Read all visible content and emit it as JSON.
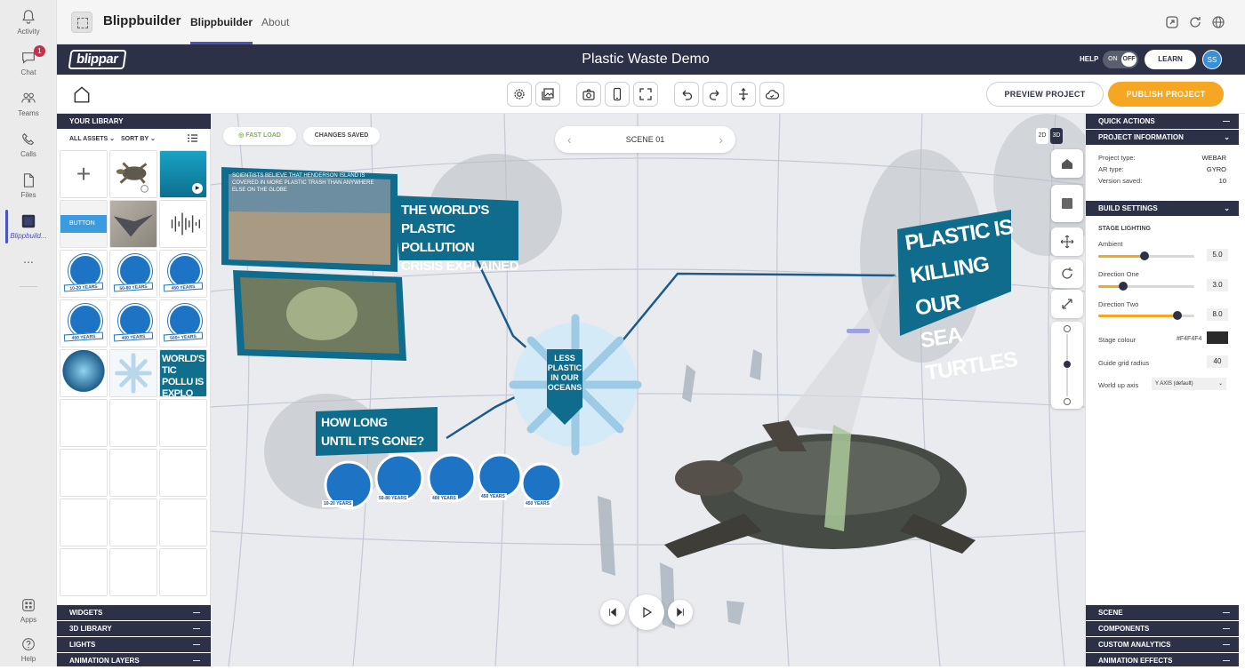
{
  "rail": {
    "items": [
      {
        "label": "Activity",
        "icon": "bell-icon"
      },
      {
        "label": "Chat",
        "icon": "chat-icon",
        "badge": "1"
      },
      {
        "label": "Teams",
        "icon": "teams-icon"
      },
      {
        "label": "Calls",
        "icon": "phone-icon"
      },
      {
        "label": "Files",
        "icon": "file-icon"
      },
      {
        "label": "Blippbuild...",
        "icon": "blippbuilder-app-icon"
      }
    ],
    "more": "...",
    "apps_label": "Apps",
    "help_label": "Help"
  },
  "teams_header": {
    "app_name": "Blippbuilder",
    "tabs": [
      "Blippbuilder",
      "About"
    ],
    "active_tab": "Blippbuilder"
  },
  "blippar_bar": {
    "logo": "blippar",
    "project_title": "Plastic Waste Demo",
    "help_label": "HELP",
    "toggle_on": "ON",
    "toggle_off": "OFF",
    "learn_label": "LEARN",
    "avatar_initials": "SS"
  },
  "toolbar": {
    "preview_label": "PREVIEW PROJECT",
    "publish_label": "PUBLISH PROJECT"
  },
  "library": {
    "title": "YOUR LIBRARY",
    "all_assets": "ALL ASSETS",
    "sort_by": "SORT BY",
    "button_asset": "BUTTON",
    "plastic_tags": [
      "10-20 YEARS",
      "50-80 YEARS",
      "450 YEARS",
      "450 YEARS",
      "400 YEARS",
      "500+ YEARS"
    ],
    "thumb_text": "WORLD'S TIC POLLU IS EXPLO",
    "sections": [
      "WIDGETS",
      "3D LIBRARY",
      "LIGHTS",
      "ANIMATION LAYERS"
    ],
    "collapse_symbol": "—"
  },
  "scene": {
    "fast_load": "FAST LOAD",
    "changes_saved": "CHANGES SAVED",
    "scene_name": "SCENE 01",
    "view_2d": "2D",
    "view_3d": "3D",
    "billboard_text": "SCIENTISTS BELIEVE THAT HENDERSON ISLAND IS COVERED IN MORE PLASTIC TRASH THAN ANYWHERE ELSE ON THE GLOBE",
    "headline_crisis": [
      "THE WORLD'S",
      "PLASTIC POLLUTION",
      "CRISIS EXPLAINED"
    ],
    "headline_turtles": [
      "PLASTIC IS",
      "KILLING OUR",
      "SEA TURTLES"
    ],
    "headline_howlong": [
      "HOW LONG",
      "UNTIL IT'S GONE?"
    ],
    "center_badge": [
      "LESS",
      "PLASTIC",
      "IN OUR",
      "OCEANS"
    ],
    "year_tags": [
      "10-20 YEARS",
      "50-80 YEARS",
      "400 YEARS",
      "450 YEARS",
      "450 YEARS"
    ]
  },
  "right_panel": {
    "quick_actions": "QUICK ACTIONS",
    "project_information": "PROJECT INFORMATION",
    "project_type_label": "Project type:",
    "project_type": "WEBAR",
    "ar_type_label": "AR type:",
    "ar_type": "GYRO",
    "version_label": "Version saved:",
    "version": "10",
    "build_settings": "BUILD SETTINGS",
    "stage_lighting": "STAGE LIGHTING",
    "ambient_label": "Ambient",
    "ambient_value": "5.0",
    "ambient_level": 0.48,
    "dir_one_label": "Direction One",
    "dir_one_value": "3.0",
    "dir_one_level": 0.26,
    "dir_two_label": "Direction Two",
    "dir_two_value": "8.0",
    "dir_two_level": 0.82,
    "stage_colour_label": "Stage colour",
    "stage_colour_value": "#F4F4F4",
    "guide_radius_label": "Guide grid radius",
    "guide_radius_value": "40",
    "world_up_label": "World up axis",
    "world_up_value": "Y AXIS (default)",
    "bottom_sections": [
      "SCENE",
      "COMPONENTS",
      "CUSTOM ANALYTICS",
      "ANIMATION EFFECTS"
    ],
    "collapse_symbol": "—"
  },
  "colors": {
    "navy": "#2c3147",
    "publish": "#f5a623",
    "teams_accent": "#4b53bc",
    "ocean_blue": "#1d74c4"
  }
}
